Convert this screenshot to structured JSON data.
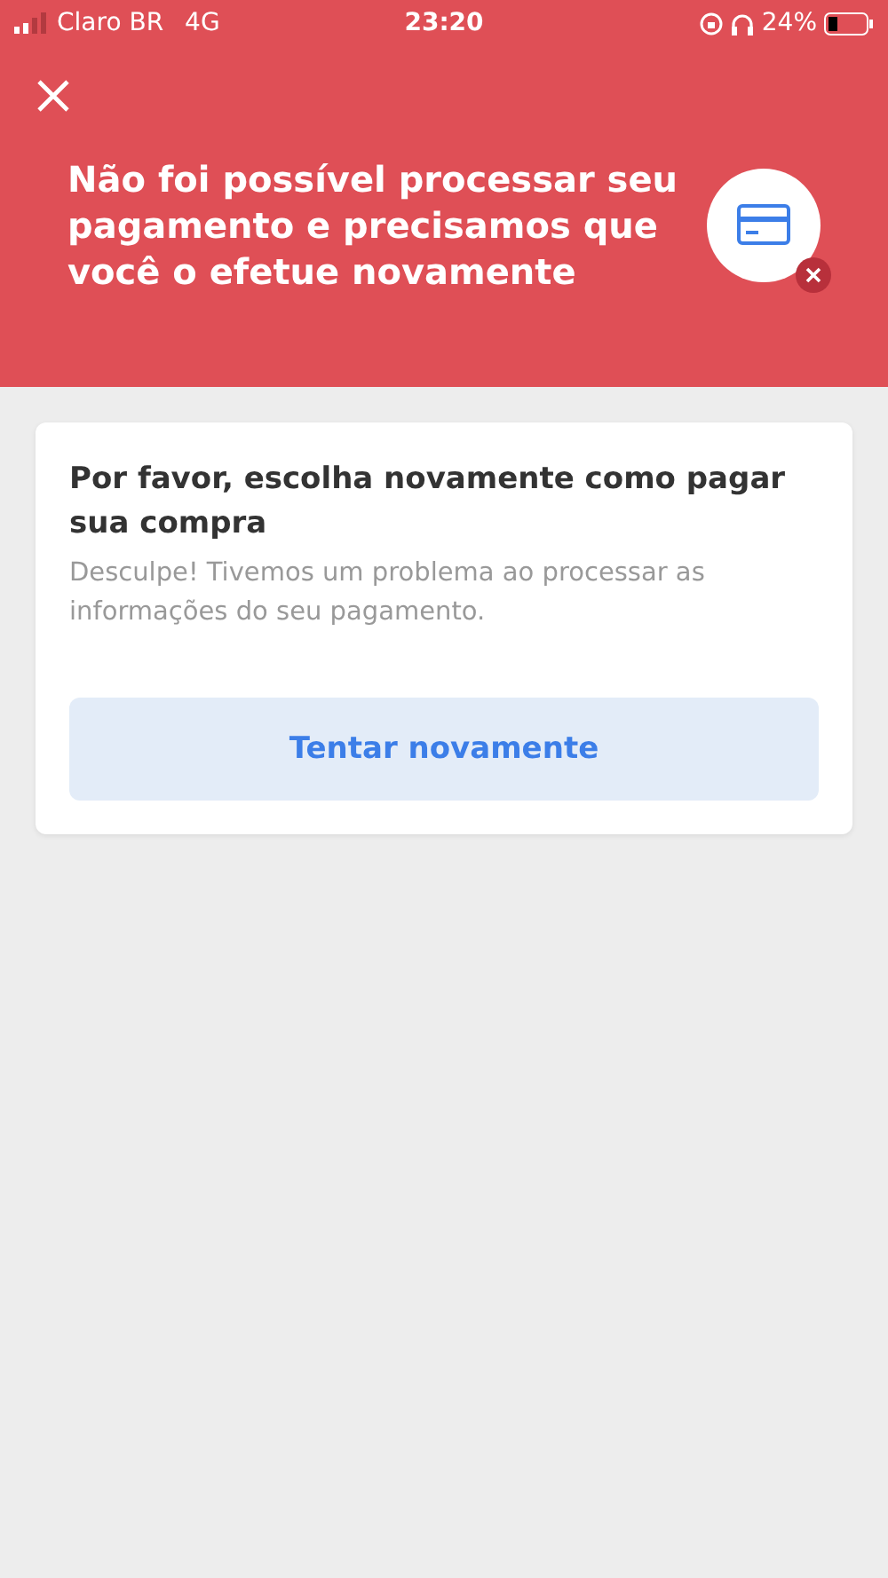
{
  "status_bar": {
    "carrier": "Claro BR",
    "network": "4G",
    "time": "23:20",
    "battery": "24%"
  },
  "header": {
    "title": "Não foi possível processar seu pagamento e precisamos que você o efetue novamente"
  },
  "card": {
    "title": "Por favor, escolha novamente como pagar sua compra",
    "message": "Desculpe! Tivemos um problema ao processar as informações do seu pagamento.",
    "button": "Tentar novamente"
  }
}
